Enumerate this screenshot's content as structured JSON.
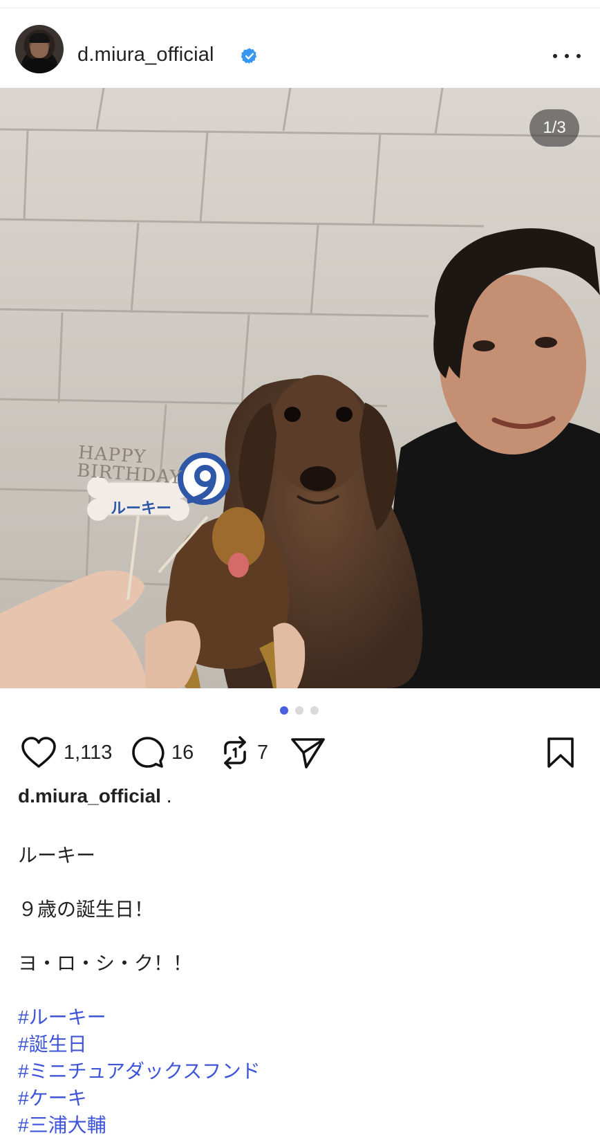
{
  "post": {
    "username": "d.miura_official",
    "counter": "1/3",
    "slides": 3,
    "active_slide": 1
  },
  "actions": {
    "likes": "1,113",
    "comments": "16",
    "reposts": "7"
  },
  "caption": {
    "username": "d.miura_official",
    "suffix": " .",
    "lines": [
      "ルーキー",
      "９歳の誕生日！",
      "ヨ・ロ・シ・ク！！"
    ],
    "hashtags": [
      "#ルーキー",
      "#誕生日",
      "#ミニチュアダックスフンド",
      "#ケーキ",
      "#三浦大輔"
    ]
  },
  "photo": {
    "topper_text": "HAPPY BIRTHDAY",
    "bone_text": "ルーキー",
    "number_text": "9"
  },
  "colors": {
    "verified": "#3897f0",
    "hashtag": "#3e55d8",
    "active_dot": "#4a5fe0"
  },
  "icons": {
    "like": "heart-icon",
    "comment": "comment-bubble-icon",
    "repost": "repost-icon",
    "share": "send-icon",
    "save": "bookmark-icon",
    "more": "more-horizontal-icon",
    "verified": "verified-badge-icon"
  }
}
